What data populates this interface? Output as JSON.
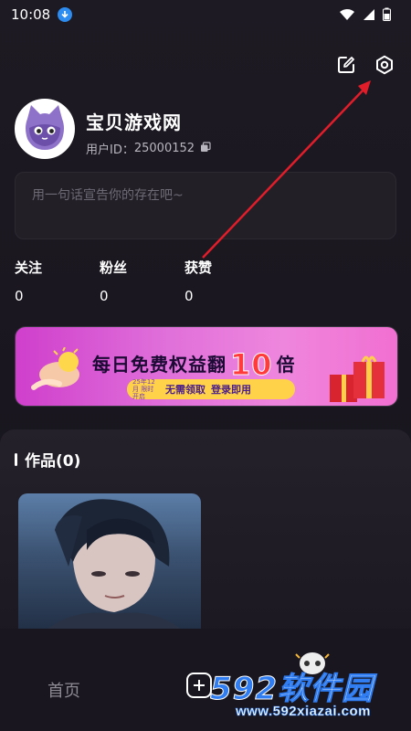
{
  "status_bar": {
    "time": "10:08",
    "icons": [
      "download-icon",
      "wifi-icon",
      "signal-icon",
      "battery-icon"
    ]
  },
  "header_actions": {
    "icons": [
      "edit-icon",
      "settings-icon"
    ]
  },
  "profile": {
    "nickname": "宝贝游戏网",
    "user_id_label": "用户ID：",
    "user_id": "25000152",
    "bio_placeholder": "用一句话宣告你的存在吧~"
  },
  "stats": [
    {
      "label": "关注",
      "value": "0"
    },
    {
      "label": "粉丝",
      "value": "0"
    },
    {
      "label": "获赞",
      "value": "0"
    }
  ],
  "banner": {
    "title_prefix": "每日免费权益翻",
    "title_number": "10",
    "title_suffix": "倍",
    "date_note": "25年12月 限时开启",
    "tag_1": "无需领取",
    "tag_2": "登录即用"
  },
  "works": {
    "title": "作品(0)"
  },
  "bottom_nav": {
    "home": "首页"
  },
  "watermark": {
    "num": "592",
    "text": "软件园",
    "url": "www.592xiazai.com"
  },
  "colors": {
    "background": "#17141d",
    "annotation_arrow": "#e11d2a",
    "banner_pink": "#e070da",
    "banner_pill": "#ffd24a",
    "watermark_blue": "#2f7df1"
  }
}
